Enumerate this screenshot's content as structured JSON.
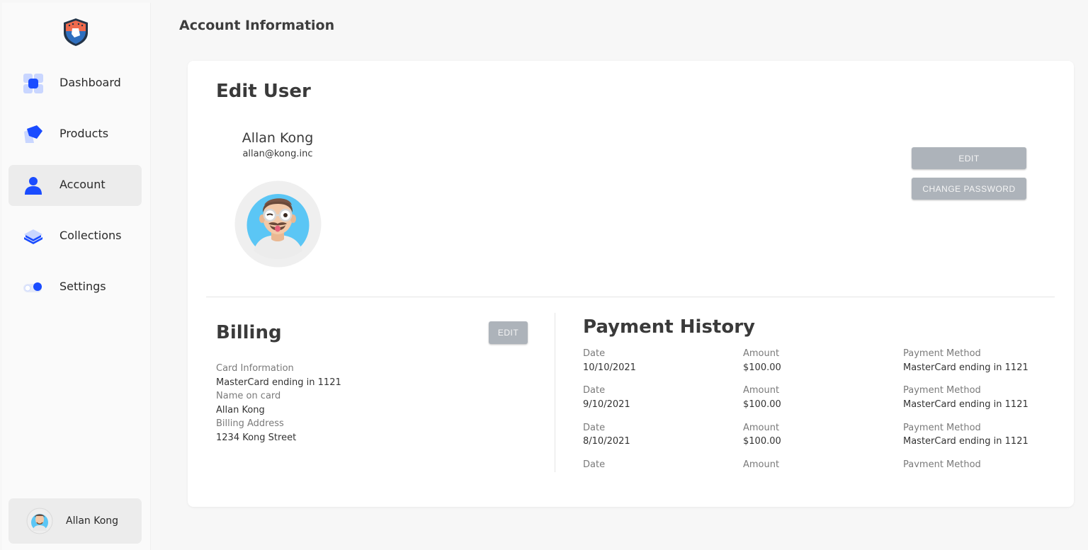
{
  "sidebar": {
    "items": [
      {
        "label": "Dashboard"
      },
      {
        "label": "Products"
      },
      {
        "label": "Account"
      },
      {
        "label": "Collections"
      },
      {
        "label": "Settings"
      }
    ],
    "active_item": "Account",
    "user": {
      "name": "Allan Kong"
    }
  },
  "header": {
    "title": "Account Information"
  },
  "edit_user": {
    "title": "Edit User",
    "name": "Allan Kong",
    "email": "allan@kong.inc",
    "edit_button": "EDIT",
    "change_password_button": "CHANGE PASSWORD"
  },
  "billing": {
    "title": "Billing",
    "edit_button": "EDIT",
    "fields": [
      {
        "label": "Card Information",
        "value": "MasterCard ending in 1121"
      },
      {
        "label": "Name on card",
        "value": "Allan Kong"
      },
      {
        "label": "Billing Address",
        "value": "1234 Kong Street"
      }
    ]
  },
  "payment_history": {
    "title": "Payment History",
    "columns": [
      "Date",
      "Amount",
      "Payment Method"
    ],
    "rows": [
      {
        "date": "10/10/2021",
        "amount": "$100.00",
        "method": "MasterCard ending in 1121"
      },
      {
        "date": "9/10/2021",
        "amount": "$100.00",
        "method": "MasterCard ending in 1121"
      },
      {
        "date": "8/10/2021",
        "amount": "$100.00",
        "method": "MasterCard ending in 1121"
      },
      {
        "date": "",
        "amount": "",
        "method": ""
      }
    ]
  },
  "colors": {
    "accent": "#1a4cff",
    "accent_light": "#c9d6ff",
    "button_gray": "#adb3ba",
    "active_bg": "#ececec",
    "avatar_bg": "#5bc6f5"
  }
}
